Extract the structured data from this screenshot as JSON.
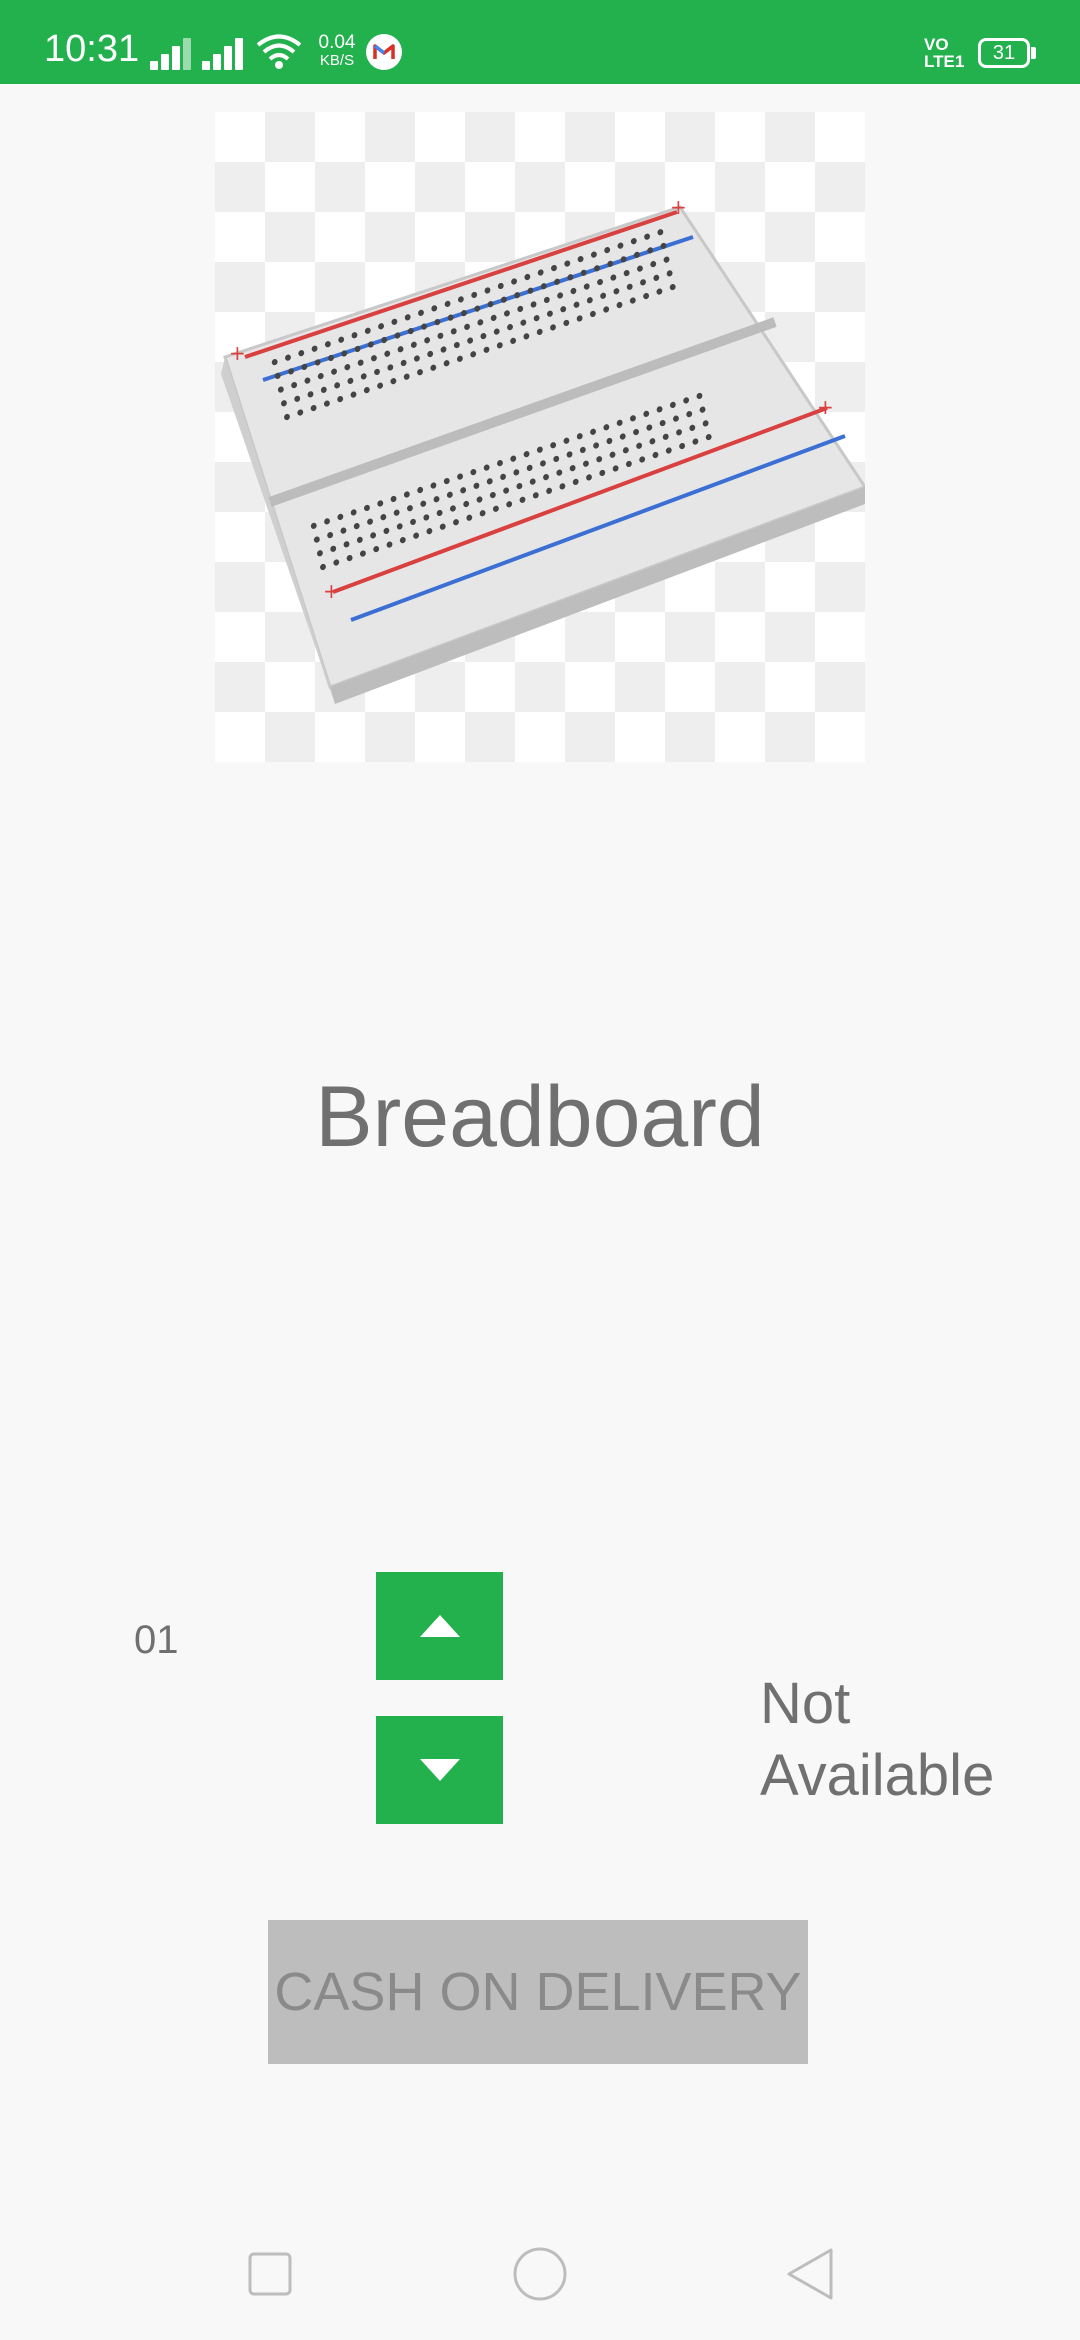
{
  "status_bar": {
    "time": "10:31",
    "net_speed_value": "0.04",
    "net_speed_unit": "KB/S",
    "volte_line1": "VO",
    "volte_line2": "LTE1",
    "battery": "31",
    "color": "#23b14d",
    "icons": [
      "signal-icon",
      "signal-icon",
      "wifi-icon",
      "gmail-icon",
      "battery-icon"
    ]
  },
  "product": {
    "title": "Breadboard",
    "image_icon": "breadboard-image"
  },
  "quantity": {
    "value": "01",
    "up_icon": "chevron-up-icon",
    "down_icon": "chevron-down-icon",
    "button_color": "#23b14d"
  },
  "availability": {
    "line1": "Not",
    "line2": "Available"
  },
  "cod_button": {
    "label": "CASH ON DELIVERY"
  },
  "nav_bar": {
    "icons": [
      "recents-icon",
      "home-icon",
      "back-icon"
    ]
  }
}
